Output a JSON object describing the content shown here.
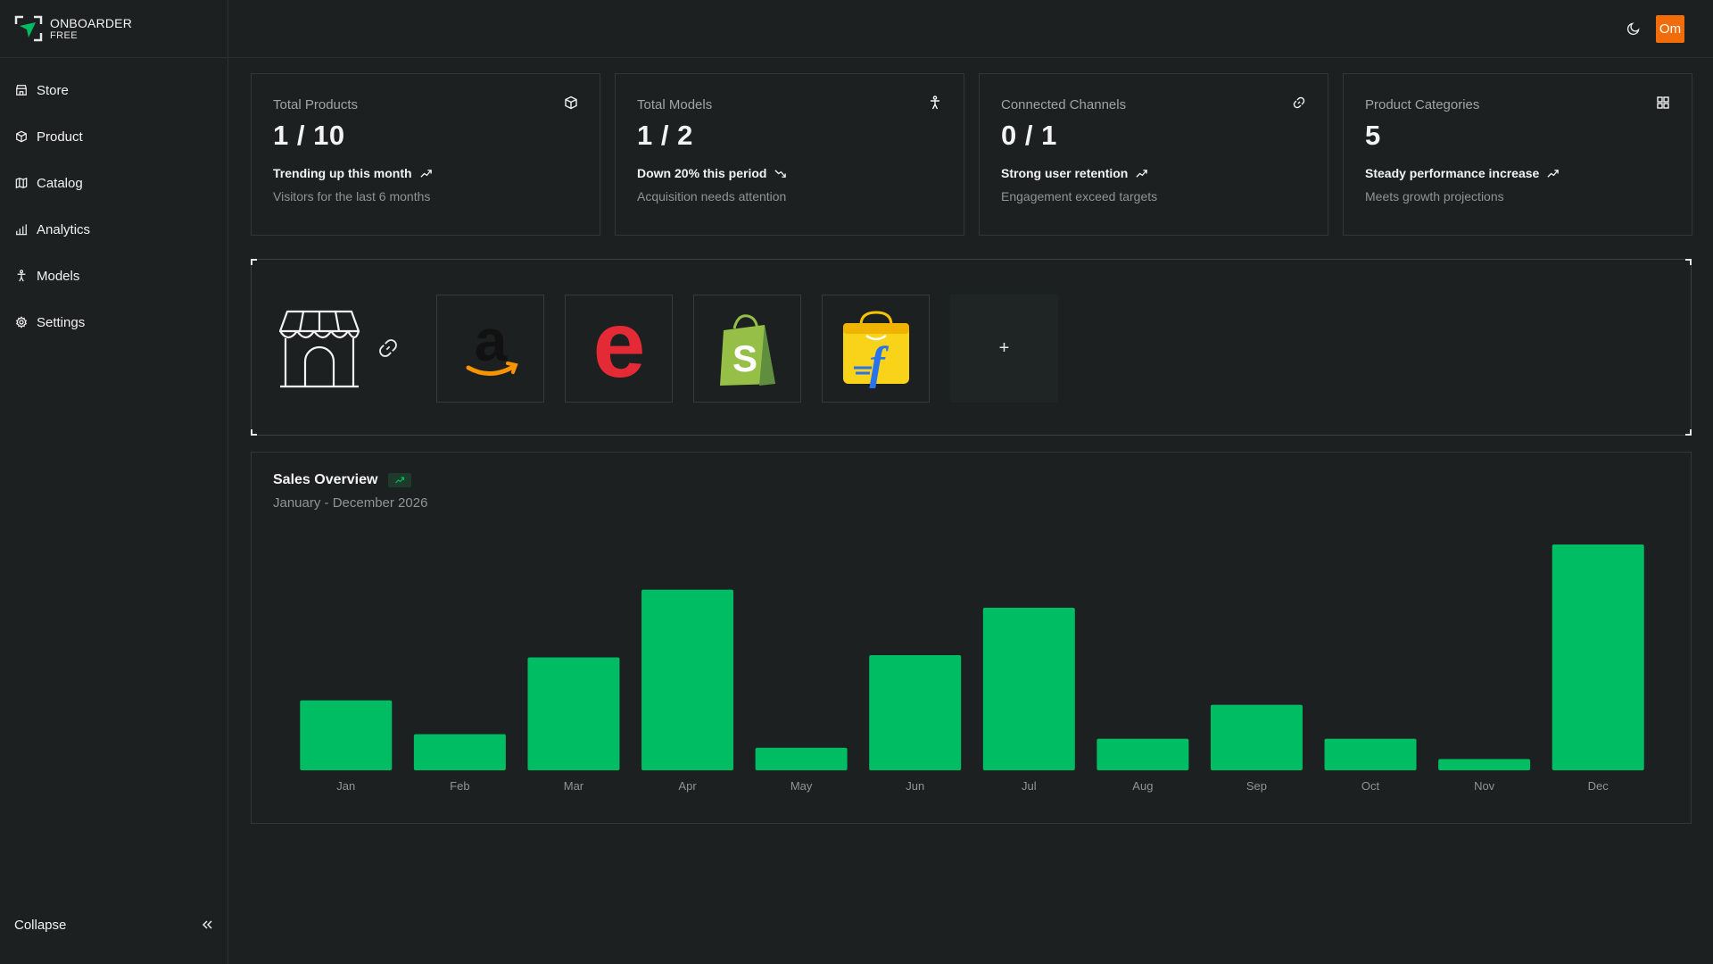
{
  "brand": {
    "name": "ONBOARDER",
    "tier": "FREE"
  },
  "sidebar": {
    "items": [
      {
        "label": "Store",
        "icon": "store-icon"
      },
      {
        "label": "Product",
        "icon": "box-icon"
      },
      {
        "label": "Catalog",
        "icon": "map-icon"
      },
      {
        "label": "Analytics",
        "icon": "bar-chart-icon"
      },
      {
        "label": "Models",
        "icon": "person-icon"
      },
      {
        "label": "Settings",
        "icon": "gear-icon"
      }
    ],
    "collapse_label": "Collapse"
  },
  "header": {
    "avatar_initials": "Om",
    "avatar_color": "#f26d0a"
  },
  "cards": [
    {
      "label": "Total Products",
      "value": "1 / 10",
      "trend": "Trending up this month",
      "trend_direction": "up",
      "sub": "Visitors for the last 6 months",
      "icon": "box-icon"
    },
    {
      "label": "Total Models",
      "value": "1 / 2",
      "trend": "Down 20% this period",
      "trend_direction": "down",
      "sub": "Acquisition needs attention",
      "icon": "person-icon"
    },
    {
      "label": "Connected Channels",
      "value": "0 / 1",
      "trend": "Strong user retention",
      "trend_direction": "up",
      "sub": "Engagement exceed targets",
      "icon": "link-icon"
    },
    {
      "label": "Product Categories",
      "value": "5",
      "trend": "Steady performance increase",
      "trend_direction": "up",
      "sub": "Meets growth projections",
      "icon": "grid-icon"
    }
  ],
  "channels": {
    "items": [
      {
        "name": "Amazon",
        "icon": "amazon-logo-icon"
      },
      {
        "name": "Etsy",
        "icon": "etsy-logo-icon"
      },
      {
        "name": "Shopify",
        "icon": "shopify-logo-icon"
      },
      {
        "name": "Flipkart",
        "icon": "flipkart-logo-icon"
      }
    ],
    "add_label": "+"
  },
  "sales": {
    "title": "Sales Overview",
    "subtitle": "January - December 2026"
  },
  "colors": {
    "accent": "#00bd63",
    "background": "#1c2020",
    "border": "#313636"
  },
  "chart_data": {
    "type": "bar",
    "categories": [
      "Jan",
      "Feb",
      "Mar",
      "Apr",
      "May",
      "Jun",
      "Jul",
      "Aug",
      "Sep",
      "Oct",
      "Nov",
      "Dec"
    ],
    "values": [
      31,
      16,
      50,
      80,
      10,
      51,
      72,
      14,
      29,
      14,
      5,
      100
    ],
    "ylim": [
      0,
      100
    ],
    "grid": false,
    "title": "",
    "xlabel": "",
    "ylabel": ""
  }
}
